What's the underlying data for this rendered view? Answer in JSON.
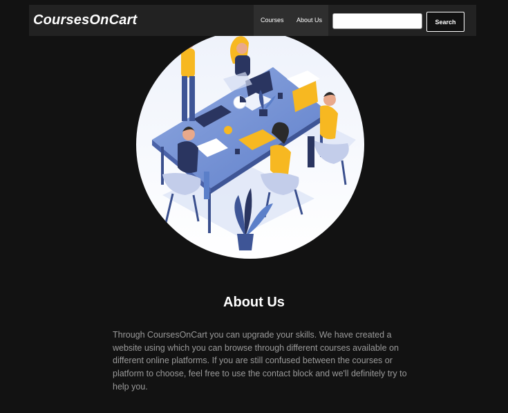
{
  "brand": {
    "name": "CoursesOnCart"
  },
  "nav": {
    "links": [
      {
        "label": "Courses"
      },
      {
        "label": "About Us"
      }
    ]
  },
  "search": {
    "placeholder": "",
    "value": "",
    "button_label": "Search"
  },
  "hero": {
    "illustration": "team-meeting-illustration"
  },
  "about": {
    "title": "About Us",
    "body": "Through CoursesOnCart you can upgrade your skills. We have created a website using which you can browse through different courses available on different online platforms. If you are still confused between the courses or platform to choose, feel free to use the contact block and we'll definitely try to help you."
  },
  "colors": {
    "page_bg": "#121212",
    "navbar_bg": "#222222",
    "nav_links_bg": "#2e2e2e",
    "text_muted": "#9a9a9a",
    "accent_yellow": "#f7b821",
    "accent_blue": "#5b7fc9"
  }
}
